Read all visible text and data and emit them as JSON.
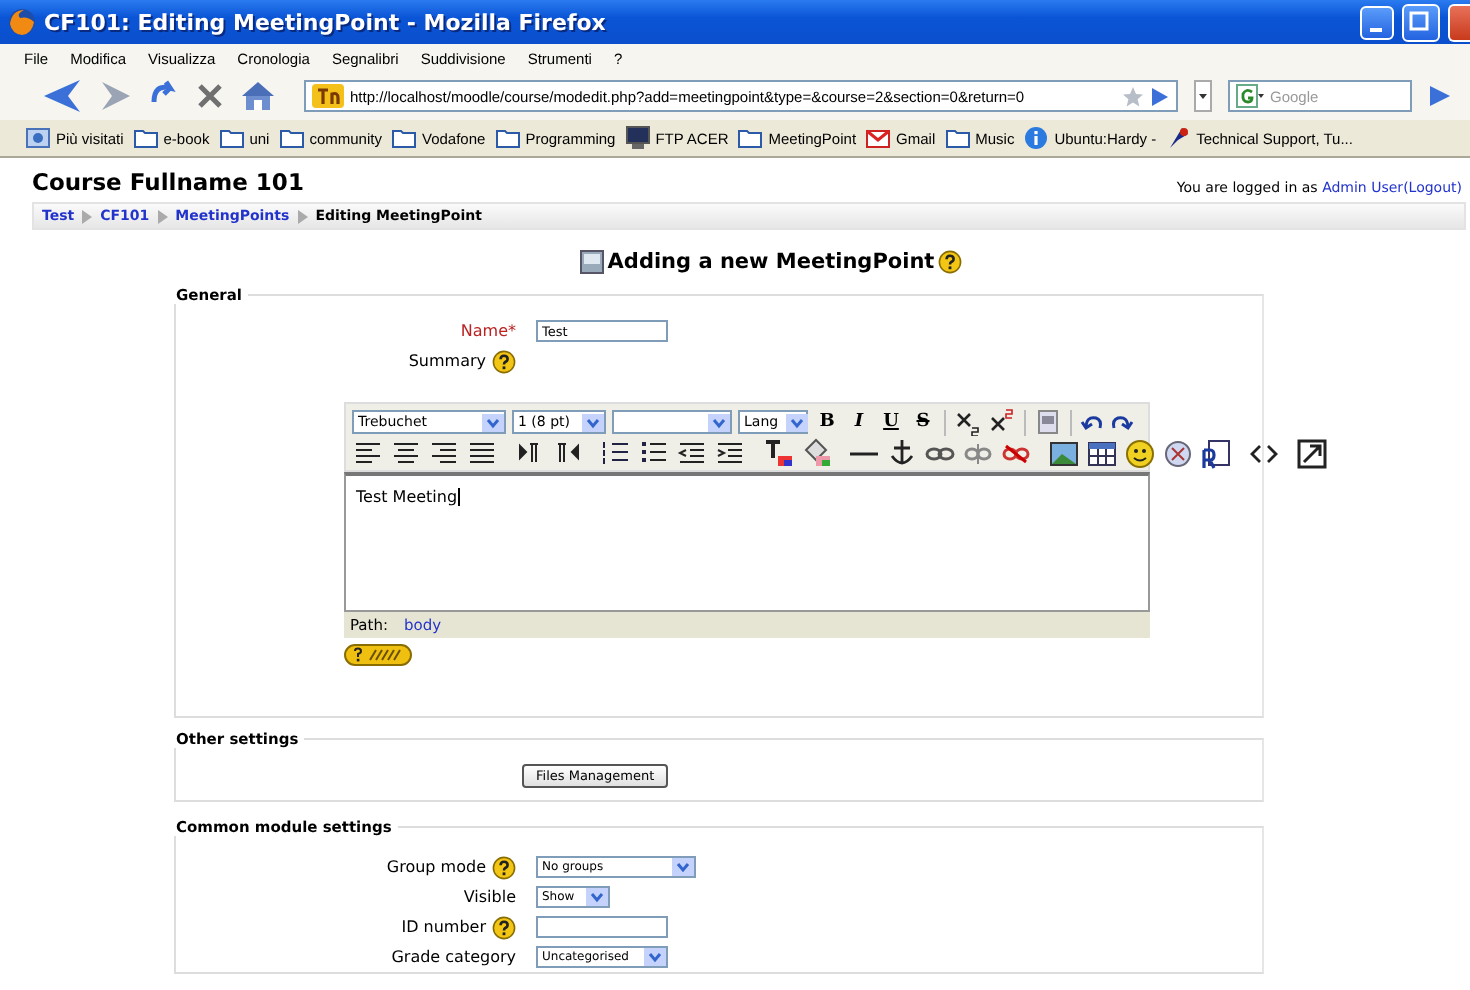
{
  "window": {
    "title": "CF101: Editing MeetingPoint - Mozilla Firefox"
  },
  "menu": [
    "File",
    "Modifica",
    "Visualizza",
    "Cronologia",
    "Segnalibri",
    "Suddivisione",
    "Strumenti",
    "?"
  ],
  "address": {
    "value": "http://localhost/moodle/course/modedit.php?add=meetingpoint&type=&course=2&section=0&return=0"
  },
  "search": {
    "placeholder": "Google"
  },
  "bookmarks": [
    {
      "kind": "special",
      "label": "Più visitati"
    },
    {
      "kind": "folder",
      "label": "e-book"
    },
    {
      "kind": "folder",
      "label": "uni"
    },
    {
      "kind": "folder",
      "label": "community"
    },
    {
      "kind": "folder",
      "label": "Vodafone"
    },
    {
      "kind": "folder",
      "label": "Programming"
    },
    {
      "kind": "monitor",
      "label": "FTP ACER"
    },
    {
      "kind": "folder",
      "label": "MeetingPoint"
    },
    {
      "kind": "mail",
      "label": "Gmail"
    },
    {
      "kind": "folder",
      "label": "Music"
    },
    {
      "kind": "info",
      "label": "Ubuntu:Hardy -"
    },
    {
      "kind": "pin",
      "label": "Technical Support, Tu..."
    }
  ],
  "header": {
    "course": "Course Fullname 101",
    "login_prefix": "You are logged in as",
    "user": "Admin User",
    "logout": "(Logout)"
  },
  "breadcrumb": [
    {
      "label": "Test",
      "link": true
    },
    {
      "label": "CF101",
      "link": true
    },
    {
      "label": "MeetingPoints",
      "link": true
    },
    {
      "label": "Editing MeetingPoint",
      "link": false
    }
  ],
  "heading": "Adding a new MeetingPoint",
  "general": {
    "legend": "General",
    "name_label": "Name",
    "required_mark": "*",
    "name_value": "Test",
    "summary_label": "Summary"
  },
  "editor": {
    "font": "Trebuchet",
    "size": "1 (8 pt)",
    "lang": "Lang",
    "text_buttons": [
      "B",
      "I",
      "U",
      "S"
    ],
    "content": "Test Meeting",
    "path_label": "Path:",
    "path": "body"
  },
  "other": {
    "legend": "Other settings",
    "button": "Files Management"
  },
  "common": {
    "legend": "Common module settings",
    "rows": [
      {
        "kind": "select",
        "label": "Group mode",
        "help": true,
        "value": "No groups"
      },
      {
        "kind": "select",
        "label": "Visible",
        "help": false,
        "value": "Show"
      },
      {
        "kind": "text",
        "label": "ID number",
        "help": true
      },
      {
        "kind": "select",
        "label": "Grade category",
        "help": false,
        "value": "Uncategorised"
      }
    ]
  }
}
